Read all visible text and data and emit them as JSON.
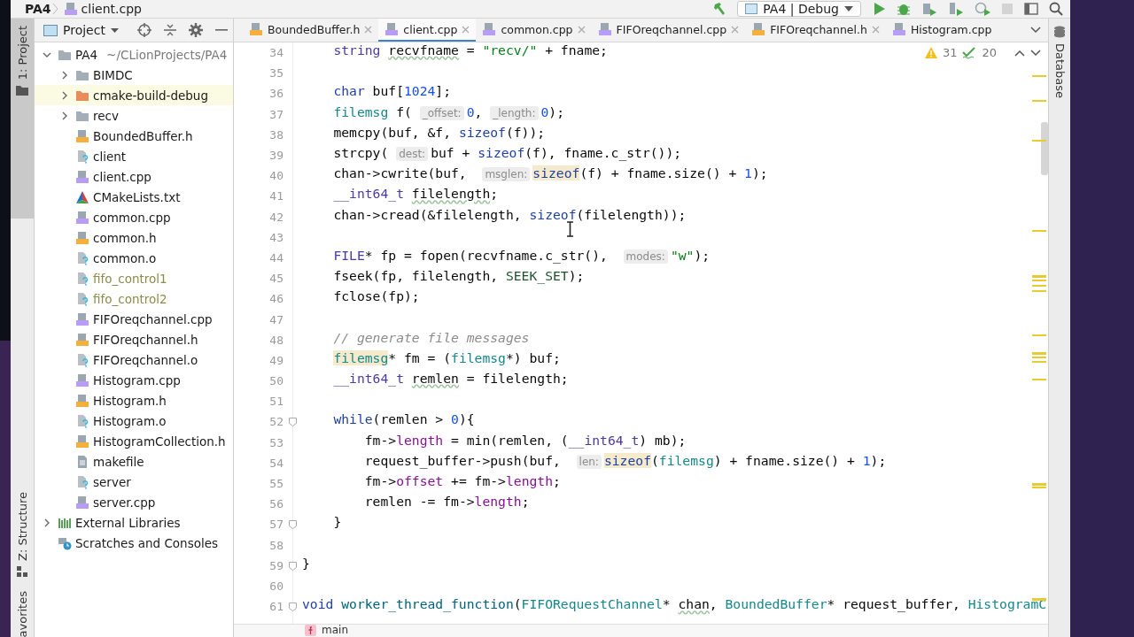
{
  "title_bar": {
    "breadcrumb": [
      "PA4",
      "client.cpp"
    ],
    "run_config": "PA4 | Debug"
  },
  "tool_strip": {
    "left": [
      {
        "label": "1: Project",
        "selected": true
      },
      {
        "label": "Z: Structure",
        "selected": false
      },
      {
        "label": "avorites",
        "selected": false
      }
    ],
    "right": [
      {
        "label": "Database",
        "selected": false
      }
    ]
  },
  "project": {
    "title": "Project",
    "tree": [
      {
        "label": "PA4",
        "path": "~/CLionProjects/PA4",
        "kind": "folder",
        "expanded": true,
        "highlighted": false,
        "ignored": false,
        "children": [
          {
            "label": "BIMDC",
            "kind": "folder",
            "expanded": false,
            "highlighted": false,
            "ignored": false
          },
          {
            "label": "cmake-build-debug",
            "kind": "excluded",
            "expanded": false,
            "highlighted": true,
            "ignored": false
          },
          {
            "label": "recv",
            "kind": "folder",
            "expanded": false,
            "highlighted": false,
            "ignored": false
          },
          {
            "label": "BoundedBuffer.h",
            "kind": "header",
            "highlighted": false,
            "ignored": false
          },
          {
            "label": "client",
            "kind": "unknown",
            "highlighted": false,
            "ignored": false
          },
          {
            "label": "client.cpp",
            "kind": "source",
            "highlighted": false,
            "ignored": false
          },
          {
            "label": "CMakeLists.txt",
            "kind": "cmake",
            "highlighted": false,
            "ignored": false
          },
          {
            "label": "common.cpp",
            "kind": "source",
            "highlighted": false,
            "ignored": false
          },
          {
            "label": "common.h",
            "kind": "header",
            "highlighted": false,
            "ignored": false
          },
          {
            "label": "common.o",
            "kind": "unknown",
            "highlighted": false,
            "ignored": false
          },
          {
            "label": "fifo_control1",
            "kind": "unknown",
            "highlighted": false,
            "ignored": true
          },
          {
            "label": "fifo_control2",
            "kind": "unknown",
            "highlighted": false,
            "ignored": true
          },
          {
            "label": "FIFOreqchannel.cpp",
            "kind": "source",
            "highlighted": false,
            "ignored": false
          },
          {
            "label": "FIFOreqchannel.h",
            "kind": "header",
            "highlighted": false,
            "ignored": false
          },
          {
            "label": "FIFOreqchannel.o",
            "kind": "unknown",
            "highlighted": false,
            "ignored": false
          },
          {
            "label": "Histogram.cpp",
            "kind": "source",
            "highlighted": false,
            "ignored": false
          },
          {
            "label": "Histogram.h",
            "kind": "header",
            "highlighted": false,
            "ignored": false
          },
          {
            "label": "Histogram.o",
            "kind": "unknown",
            "highlighted": false,
            "ignored": false
          },
          {
            "label": "HistogramCollection.h",
            "kind": "header",
            "highlighted": false,
            "ignored": false
          },
          {
            "label": "makefile",
            "kind": "text",
            "highlighted": false,
            "ignored": false
          },
          {
            "label": "server",
            "kind": "unknown",
            "highlighted": false,
            "ignored": false
          },
          {
            "label": "server.cpp",
            "kind": "source",
            "highlighted": false,
            "ignored": false
          }
        ]
      },
      {
        "label": "External Libraries",
        "kind": "libraries",
        "expanded": false,
        "highlighted": false,
        "ignored": false
      },
      {
        "label": "Scratches and Consoles",
        "kind": "scratches",
        "highlighted": false,
        "ignored": false
      }
    ]
  },
  "tabs": [
    {
      "label": "BoundedBuffer.h",
      "kind": "header",
      "selected": false,
      "closable": true
    },
    {
      "label": "client.cpp",
      "kind": "source",
      "selected": true,
      "closable": true
    },
    {
      "label": "common.cpp",
      "kind": "source",
      "selected": false,
      "closable": true
    },
    {
      "label": "FIFOreqchannel.cpp",
      "kind": "source",
      "selected": false,
      "closable": true
    },
    {
      "label": "FIFOreqchannel.h",
      "kind": "header",
      "selected": false,
      "closable": true
    },
    {
      "label": "Histogram.cpp",
      "kind": "source",
      "selected": false,
      "closable": false
    }
  ],
  "inspections": {
    "warnings": "31",
    "typos": "20"
  },
  "editor": {
    "lines": [
      {
        "number": "34",
        "kind": "block",
        "fold": false,
        "tokens": [
          {
            "kind": "t2",
            "text": "string "
          },
          {
            "kind": "w",
            "text": "recvfname"
          },
          {
            "kind": "p",
            "text": " = "
          },
          {
            "kind": "s",
            "text": "\"recv/\""
          },
          {
            "kind": "p",
            "text": " + fname;"
          }
        ]
      },
      {
        "number": "35",
        "kind": "blank",
        "fold": false
      },
      {
        "number": "36",
        "kind": "block",
        "fold": false,
        "tokens": [
          {
            "kind": "k",
            "text": "char"
          },
          {
            "kind": "p",
            "text": " buf["
          },
          {
            "kind": "n",
            "text": "1024"
          },
          {
            "kind": "p",
            "text": "];"
          }
        ]
      },
      {
        "number": "37",
        "kind": "block",
        "fold": false,
        "tokens": [
          {
            "kind": "t",
            "text": "filemsg"
          },
          {
            "kind": "p",
            "text": " f( "
          },
          {
            "kind": "h",
            "text": "_offset:"
          },
          {
            "kind": "n",
            "text": "0"
          },
          {
            "kind": "p",
            "text": ", "
          },
          {
            "kind": "h",
            "text": "_length:"
          },
          {
            "kind": "n",
            "text": "0"
          },
          {
            "kind": "p",
            "text": ");"
          }
        ]
      },
      {
        "number": "38",
        "kind": "block",
        "fold": false,
        "tokens": [
          {
            "kind": "p",
            "text": "memcpy(buf, &f, "
          },
          {
            "kind": "k",
            "text": "sizeof"
          },
          {
            "kind": "p",
            "text": "(f));"
          }
        ]
      },
      {
        "number": "39",
        "kind": "block",
        "fold": false,
        "tokens": [
          {
            "kind": "p",
            "text": "strcpy( "
          },
          {
            "kind": "h",
            "text": "dest:"
          },
          {
            "kind": "p",
            "text": "buf + "
          },
          {
            "kind": "k",
            "text": "sizeof"
          },
          {
            "kind": "p",
            "text": "(f), fname.c_str());"
          }
        ]
      },
      {
        "number": "40",
        "kind": "block",
        "fold": false,
        "tokens": [
          {
            "kind": "p",
            "text": "chan->cwrite(buf,  "
          },
          {
            "kind": "h",
            "text": "msglen:"
          },
          {
            "kind": "km",
            "text": "sizeof"
          },
          {
            "kind": "p",
            "text": "(f) + fname.size() + "
          },
          {
            "kind": "n",
            "text": "1"
          },
          {
            "kind": "p",
            "text": ");"
          }
        ]
      },
      {
        "number": "41",
        "kind": "block",
        "fold": false,
        "tokens": [
          {
            "kind": "t2",
            "text": "__int64_t "
          },
          {
            "kind": "w",
            "text": "filelength"
          },
          {
            "kind": "p",
            "text": ";"
          }
        ]
      },
      {
        "number": "42",
        "kind": "block",
        "fold": false,
        "tokens": [
          {
            "kind": "p",
            "text": "chan->cread(&filelength, "
          },
          {
            "kind": "k",
            "text": "sizeof"
          },
          {
            "kind": "p",
            "text": "(filelength));"
          }
        ]
      },
      {
        "number": "43",
        "kind": "blank",
        "fold": false
      },
      {
        "number": "44",
        "kind": "block",
        "fold": false,
        "tokens": [
          {
            "kind": "t2",
            "text": "FILE"
          },
          {
            "kind": "p",
            "text": "* fp = fopen(recvfname.c_str(),  "
          },
          {
            "kind": "h",
            "text": "modes:"
          },
          {
            "kind": "s",
            "text": "\"w\""
          },
          {
            "kind": "p",
            "text": ");"
          }
        ]
      },
      {
        "number": "45",
        "kind": "block",
        "fold": false,
        "tokens": [
          {
            "kind": "p",
            "text": "fseek(fp, filelength, "
          },
          {
            "kind": "m",
            "text": "SEEK_SET"
          },
          {
            "kind": "p",
            "text": ");"
          }
        ]
      },
      {
        "number": "46",
        "kind": "block",
        "fold": false,
        "tokens": [
          {
            "kind": "p",
            "text": "fclose(fp);"
          }
        ]
      },
      {
        "number": "47",
        "kind": "blank",
        "fold": false
      },
      {
        "number": "48",
        "kind": "block",
        "fold": false,
        "tokens": [
          {
            "kind": "c",
            "text": "// generate file messages"
          }
        ]
      },
      {
        "number": "49",
        "kind": "block",
        "fold": false,
        "tokens": [
          {
            "kind": "tm",
            "text": "filemsg"
          },
          {
            "kind": "p",
            "text": "* fm = ("
          },
          {
            "kind": "t",
            "text": "filemsg"
          },
          {
            "kind": "p",
            "text": "*) buf;"
          }
        ]
      },
      {
        "number": "50",
        "kind": "block",
        "fold": false,
        "tokens": [
          {
            "kind": "t2",
            "text": "__int64_t "
          },
          {
            "kind": "w",
            "text": "remlen"
          },
          {
            "kind": "p",
            "text": " = filelength;"
          }
        ]
      },
      {
        "number": "51",
        "kind": "blank",
        "fold": false
      },
      {
        "number": "52",
        "kind": "block",
        "fold": true,
        "tokens": [
          {
            "kind": "k",
            "text": "while"
          },
          {
            "kind": "p",
            "text": "(remlen > "
          },
          {
            "kind": "n",
            "text": "0"
          },
          {
            "kind": "p",
            "text": "){"
          }
        ]
      },
      {
        "number": "53",
        "kind": "nested",
        "fold": false,
        "tokens": [
          {
            "kind": "p",
            "text": "fm->"
          },
          {
            "kind": "f",
            "text": "length"
          },
          {
            "kind": "p",
            "text": " = min(remlen, ("
          },
          {
            "kind": "t2",
            "text": "__int64_t"
          },
          {
            "kind": "p",
            "text": ") mb);"
          }
        ]
      },
      {
        "number": "54",
        "kind": "nested",
        "fold": false,
        "tokens": [
          {
            "kind": "p",
            "text": "request_buffer->push(buf,  "
          },
          {
            "kind": "h",
            "text": "len:"
          },
          {
            "kind": "km",
            "text": "sizeof"
          },
          {
            "kind": "p",
            "text": "("
          },
          {
            "kind": "t",
            "text": "filemsg"
          },
          {
            "kind": "p",
            "text": ") + fname.size() + "
          },
          {
            "kind": "n",
            "text": "1"
          },
          {
            "kind": "p",
            "text": ");"
          }
        ]
      },
      {
        "number": "55",
        "kind": "nested",
        "fold": false,
        "tokens": [
          {
            "kind": "p",
            "text": "fm->"
          },
          {
            "kind": "f",
            "text": "offset"
          },
          {
            "kind": "p",
            "text": " += fm->"
          },
          {
            "kind": "f",
            "text": "length"
          },
          {
            "kind": "p",
            "text": ";"
          }
        ]
      },
      {
        "number": "56",
        "kind": "nested",
        "fold": false,
        "tokens": [
          {
            "kind": "p",
            "text": "remlen -= fm->"
          },
          {
            "kind": "f",
            "text": "length"
          },
          {
            "kind": "p",
            "text": ";"
          }
        ]
      },
      {
        "number": "57",
        "kind": "block",
        "fold": true,
        "tokens": [
          {
            "kind": "p",
            "text": "}"
          }
        ]
      },
      {
        "number": "58",
        "kind": "blank",
        "fold": false
      },
      {
        "number": "59",
        "kind": "top",
        "fold": true,
        "tokens": [
          {
            "kind": "p",
            "text": "}"
          }
        ]
      },
      {
        "number": "60",
        "kind": "blank",
        "fold": false
      },
      {
        "number": "61",
        "kind": "top",
        "fold": true,
        "tokens": [
          {
            "kind": "k",
            "text": "void "
          },
          {
            "kind": "fn",
            "text": "worker_thread_function"
          },
          {
            "kind": "p",
            "text": "("
          },
          {
            "kind": "t",
            "text": "FIFORequestChannel"
          },
          {
            "kind": "p",
            "text": "* "
          },
          {
            "kind": "w",
            "text": "chan"
          },
          {
            "kind": "p",
            "text": ", "
          },
          {
            "kind": "t",
            "text": "BoundedBuffer"
          },
          {
            "kind": "p",
            "text": "* request_buffer, "
          },
          {
            "kind": "t",
            "text": "HistogramC"
          }
        ]
      }
    ]
  },
  "code_breadcrumb": "main"
}
